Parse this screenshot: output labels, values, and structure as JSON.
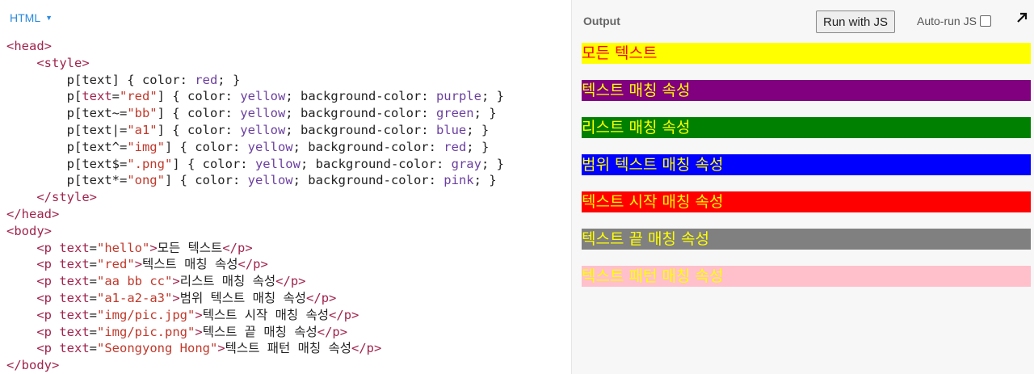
{
  "editor": {
    "language": "HTML",
    "lines": [
      [
        "<head>"
      ],
      [
        "    <style>"
      ],
      [
        "        p[text] { color: red; }"
      ],
      [
        "        p[text=\"red\"] { color: yellow; background-color: purple; }"
      ],
      [
        "        p[text~=\"bb\"] { color: yellow; background-color: green; }"
      ],
      [
        "        p[text|=\"a1\"] { color: yellow; background-color: blue; }"
      ],
      [
        "        p[text^=\"img\"] { color: yellow; background-color: red; }"
      ],
      [
        "        p[text$=\".png\"] { color: yellow; background-color: gray; }"
      ],
      [
        "        p[text*=\"ong\"] { color: yellow; background-color: pink; }"
      ],
      [
        "    </style>"
      ],
      [
        "</head>"
      ],
      [
        "<body>"
      ],
      [
        "    <p text=\"hello\">모든 텍스트</p>"
      ],
      [
        "    <p text=\"red\">텍스트 매칭 속성</p>"
      ],
      [
        "    <p text=\"aa bb cc\">리스트 매칭 속성</p>"
      ],
      [
        "    <p text=\"a1-a2-a3\">범위 텍스트 매칭 속성</p>"
      ],
      [
        "    <p text=\"img/pic.jpg\">텍스트 시작 매칭 속성</p>"
      ],
      [
        "    <p text=\"img/pic.png\">텍스트 끝 매칭 속성</p>"
      ],
      [
        "    <p text=\"Seongyong Hong\">텍스트 패턴 매칭 속성</p>"
      ],
      [
        "</body>"
      ]
    ]
  },
  "output": {
    "title": "Output",
    "run_button": "Run with JS",
    "autorun_label": "Auto-run JS",
    "results": [
      {
        "text": "모든 텍스트",
        "color": "#ff0000",
        "bg": "#ffff00"
      },
      {
        "text": "텍스트 매칭 속성",
        "color": "#ffff00",
        "bg": "#800080"
      },
      {
        "text": "리스트 매칭 속성",
        "color": "#ffff00",
        "bg": "#008000"
      },
      {
        "text": "범위 텍스트 매칭 속성",
        "color": "#ffff00",
        "bg": "#0000ff"
      },
      {
        "text": "텍스트 시작 매칭 속성",
        "color": "#ffff00",
        "bg": "#ff0000"
      },
      {
        "text": "텍스트 끝 매칭 속성",
        "color": "#ffff00",
        "bg": "#808080"
      },
      {
        "text": "텍스트 패턴 매칭 속성",
        "color": "#ffff00",
        "bg": "#ffc0cb"
      }
    ]
  }
}
